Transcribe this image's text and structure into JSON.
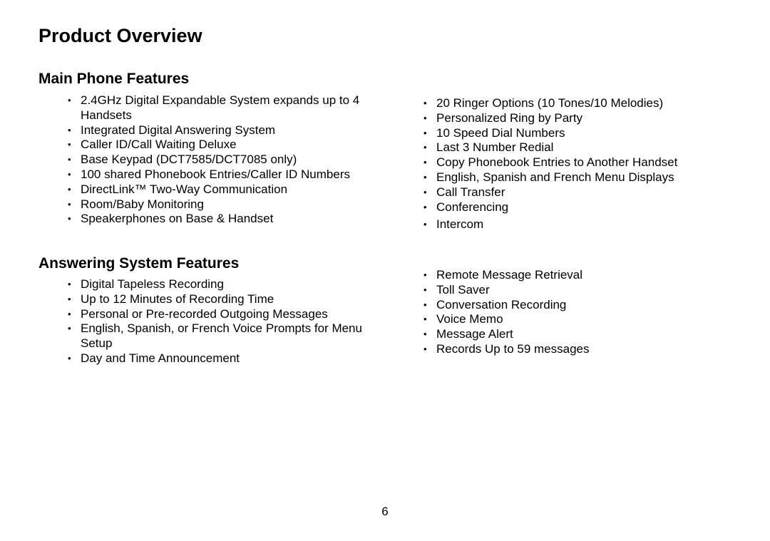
{
  "page_title": "Product Overview",
  "main_phone": {
    "title": "Main Phone Features",
    "left_items": [
      "2.4GHz Digital Expandable System expands up to 4 Handsets",
      "Integrated Digital Answering System",
      "Caller ID/Call Waiting Deluxe",
      "Base Keypad (DCT7585/DCT7085 only)",
      "100 shared Phonebook Entries/Caller ID Numbers",
      "DirectLink™ Two-Way Communication",
      "Room/Baby Monitoring",
      "Speakerphones on Base & Handset"
    ],
    "right_items": [
      "20 Ringer Options (10 Tones/10 Melodies)",
      "Personalized Ring by Party",
      "10 Speed Dial Numbers",
      "Last 3 Number Redial",
      "Copy Phonebook Entries to Another Handset",
      "English, Spanish and French Menu Displays",
      "Call Transfer",
      "Conferencing",
      "Intercom"
    ]
  },
  "answering": {
    "title": "Answering System Features",
    "left_items": [
      "Digital Tapeless Recording",
      "Up to 12 Minutes of Recording Time",
      "Personal or Pre-recorded Outgoing Messages",
      "English, Spanish, or French Voice Prompts for Menu Setup",
      "Day and Time Announcement"
    ],
    "right_items": [
      "Remote Message Retrieval",
      "Toll Saver",
      "Conversation Recording",
      "Voice Memo",
      "Message Alert",
      "Records Up to 59 messages"
    ]
  },
  "page_number": "6"
}
